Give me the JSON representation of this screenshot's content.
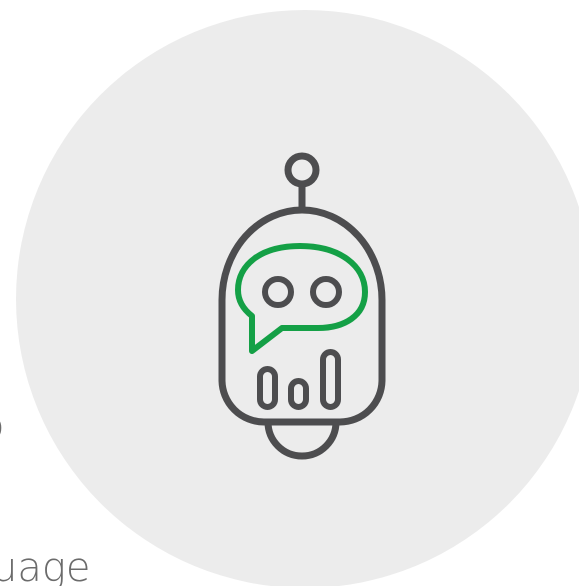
{
  "illustration": {
    "icon": "chatbot-robot-icon",
    "background_color": "#ececec",
    "stroke_color": "#4d4d4f",
    "accent_color": "#14a046"
  },
  "cropped_text": {
    "line_1": "o",
    "line_2": "uage"
  }
}
